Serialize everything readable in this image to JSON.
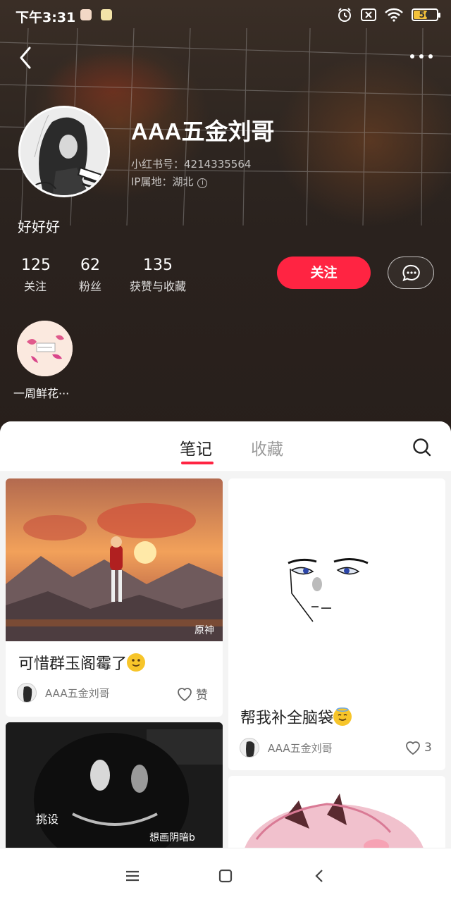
{
  "status_bar": {
    "time": "下午3:31",
    "battery": "56"
  },
  "profile": {
    "nickname": "AAA五金刘哥",
    "id_line": "小红书号：4214335564",
    "ip_line": "IP属地：湖北",
    "bio": "好好好",
    "stats": [
      {
        "value": "125",
        "label": "关注"
      },
      {
        "value": "62",
        "label": "粉丝"
      },
      {
        "value": "135",
        "label": "获赞与收藏"
      }
    ],
    "follow_label": "关注",
    "collection_label": "一周鲜花···"
  },
  "tabs": [
    {
      "label": "笔记",
      "active": true
    },
    {
      "label": "收藏",
      "active": false
    }
  ],
  "notes": [
    {
      "title": "可惜群玉阁霉了",
      "author": "AAA五金刘哥",
      "likes": "赞",
      "image_watermark": "原神"
    },
    {
      "title": "帮我补全脑袋",
      "author": "AAA五金刘哥",
      "likes": "3"
    },
    {
      "overlay_left": "挑设",
      "overlay_right": "想画阴暗b"
    },
    {}
  ],
  "colors": {
    "accent": "#ff2442",
    "header_bg": "#2a221e"
  },
  "icons": [
    "back-icon",
    "more-icon",
    "info-icon",
    "chat-icon",
    "search-icon",
    "heart-icon",
    "menu-icon",
    "home-square-icon",
    "nav-back-icon"
  ]
}
